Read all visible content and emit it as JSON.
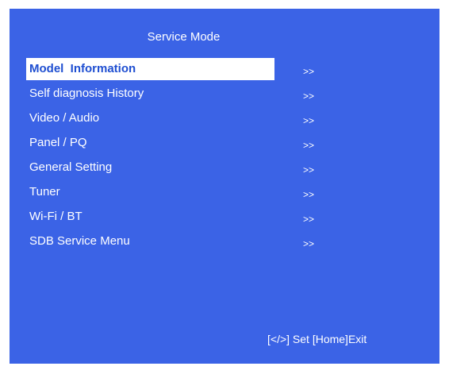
{
  "screen": {
    "title": "Service Mode",
    "background": "#3b63e6",
    "selected_index": 0
  },
  "menu": {
    "items": [
      {
        "label": "Model  Information",
        "arrow": ">>"
      },
      {
        "label": "Self diagnosis History",
        "arrow": ">>"
      },
      {
        "label": "Video / Audio",
        "arrow": ">>"
      },
      {
        "label": "Panel / PQ",
        "arrow": ">>"
      },
      {
        "label": "General Setting",
        "arrow": ">>"
      },
      {
        "label": "Tuner",
        "arrow": ">>"
      },
      {
        "label": "Wi-Fi / BT",
        "arrow": ">>"
      },
      {
        "label": "SDB Service Menu",
        "arrow": ">>"
      }
    ]
  },
  "footer": {
    "hint": "[</>] Set [Home]Exit"
  }
}
